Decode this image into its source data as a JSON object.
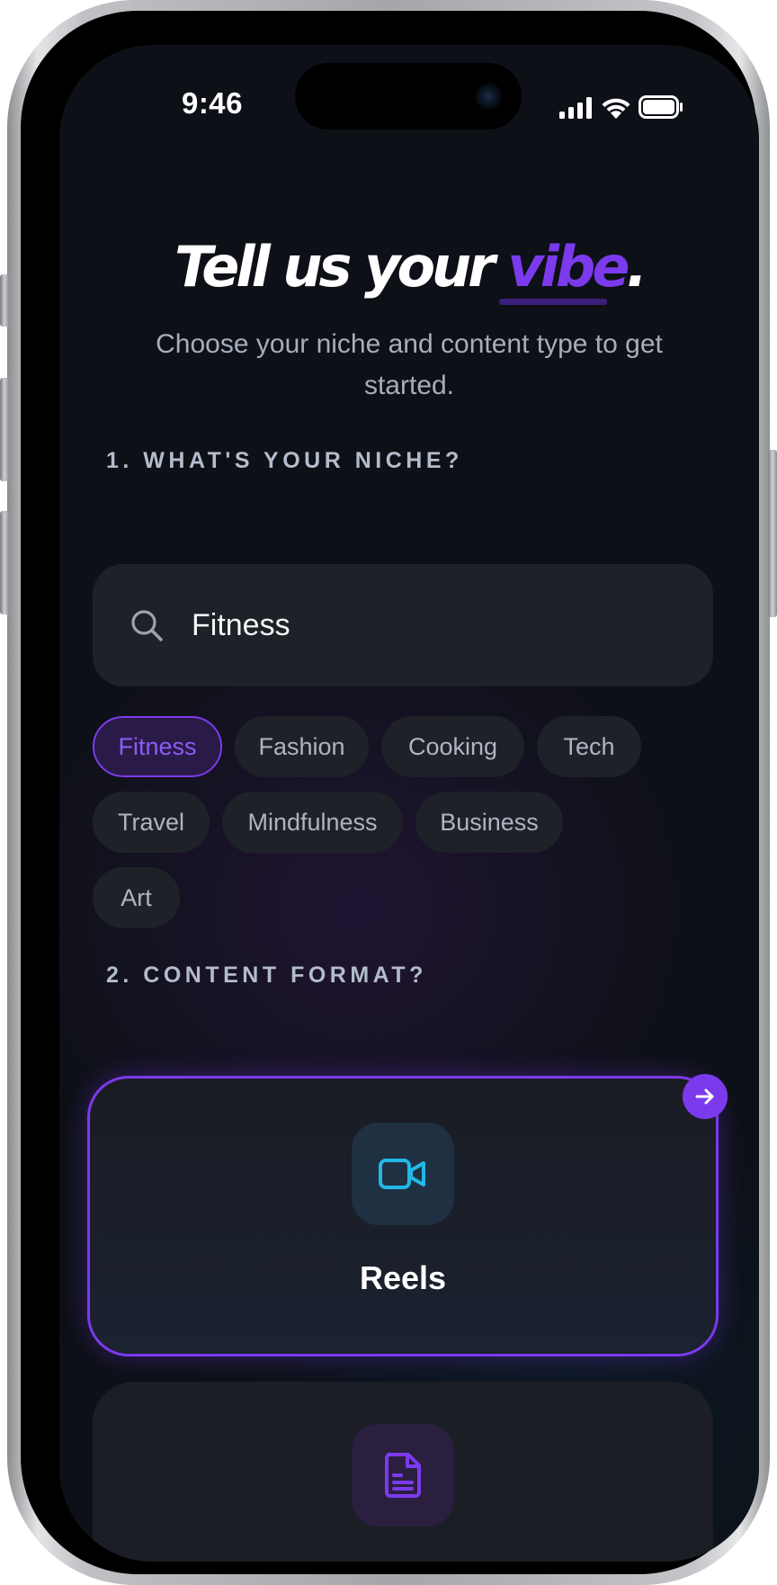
{
  "status_bar": {
    "time": "9:46",
    "icons": [
      "cellular-signal-icon",
      "wifi-icon",
      "battery-icon"
    ]
  },
  "header": {
    "title_main": "Tell us your",
    "title_accent": "vibe",
    "title_end": ".",
    "subtitle": "Choose your niche and content type to get started."
  },
  "niche_section": {
    "label": "1. WHAT'S YOUR NICHE?",
    "search": {
      "value": "Fitness",
      "icon": "search-icon"
    },
    "chips": [
      {
        "label": "Fitness",
        "selected": true
      },
      {
        "label": "Fashion",
        "selected": false
      },
      {
        "label": "Cooking",
        "selected": false
      },
      {
        "label": "Tech",
        "selected": false
      },
      {
        "label": "Travel",
        "selected": false
      },
      {
        "label": "Mindfulness",
        "selected": false
      },
      {
        "label": "Business",
        "selected": false
      },
      {
        "label": "Art",
        "selected": false
      }
    ]
  },
  "format_section": {
    "label": "2. CONTENT FORMAT?",
    "cards": [
      {
        "label": "Reels",
        "icon": "video-camera-icon",
        "selected": true
      },
      {
        "label": "",
        "icon": "document-icon",
        "selected": false
      }
    ],
    "next_icon": "arrow-right-icon"
  },
  "colors": {
    "accent": "#7c3aed",
    "background": "#0d1016",
    "surface": "#1e2128",
    "video_icon": "#22b8e6"
  }
}
